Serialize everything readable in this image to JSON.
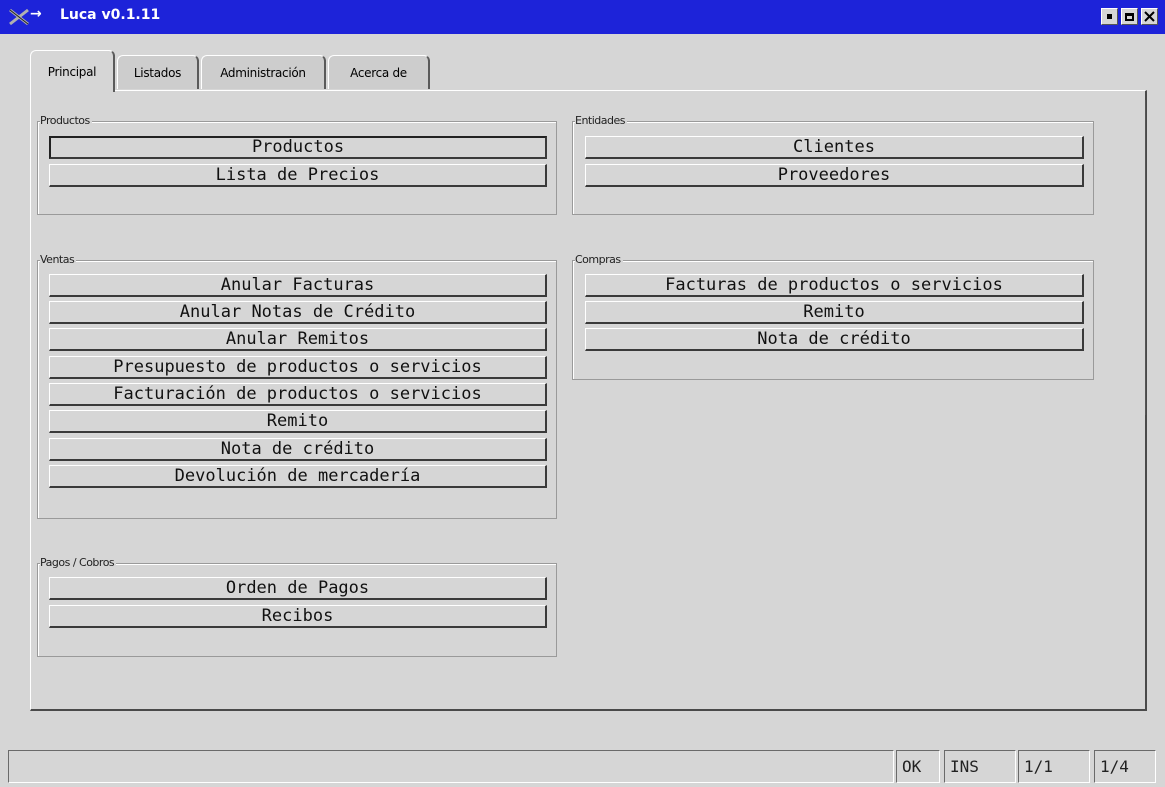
{
  "window": {
    "title": "Luca v0.1.11",
    "icon": "x-logo-icon",
    "title_arrow": "→",
    "controls": [
      "minimize-icon",
      "maximize-icon",
      "close-icon"
    ]
  },
  "tabs": [
    {
      "label": "Principal",
      "active": true
    },
    {
      "label": "Listados",
      "active": false
    },
    {
      "label": "Administración",
      "active": false
    },
    {
      "label": "Acerca de",
      "active": false
    }
  ],
  "groups": {
    "productos": {
      "label": "Productos",
      "buttons": [
        "Productos",
        "Lista de Precios"
      ]
    },
    "entidades": {
      "label": "Entidades",
      "buttons": [
        "Clientes",
        "Proveedores"
      ]
    },
    "ventas": {
      "label": "Ventas",
      "buttons": [
        "Anular Facturas",
        "Anular Notas de Crédito",
        "Anular Remitos",
        "Presupuesto de productos o servicios",
        "Facturación de productos o servicios",
        "Remito",
        "Nota de crédito",
        "Devolución de mercadería"
      ]
    },
    "compras": {
      "label": "Compras",
      "buttons": [
        "Facturas de productos o servicios",
        "Remito",
        "Nota de crédito"
      ]
    },
    "pagos": {
      "label": "Pagos / Cobros",
      "buttons": [
        "Orden de Pagos",
        "Recibos"
      ]
    }
  },
  "statusbar": {
    "message": "",
    "ok": "OK",
    "ins": "INS",
    "page": "1/1",
    "record": "1/4"
  },
  "colors": {
    "titlebar": "#1d23d9",
    "background": "#d6d6d6"
  }
}
